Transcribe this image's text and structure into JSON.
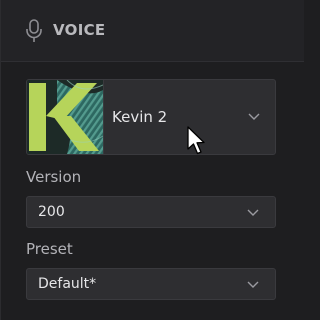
{
  "header": {
    "title": "VOICE",
    "icon": "microphone-icon"
  },
  "voice": {
    "name": "Kevin 2",
    "thumbnail_icon": "k-letter-logo"
  },
  "version": {
    "label": "Version",
    "value": "200"
  },
  "preset": {
    "label": "Preset",
    "value": "Default*"
  },
  "colors": {
    "background": "#1e1e20",
    "header_bg": "#232326",
    "control_bg": "#2e2e31",
    "text": "#e6e6e8",
    "label_text": "#b3b3b8",
    "logo_green": "#b6d45a",
    "logo_teal": "#3c8e7c"
  }
}
